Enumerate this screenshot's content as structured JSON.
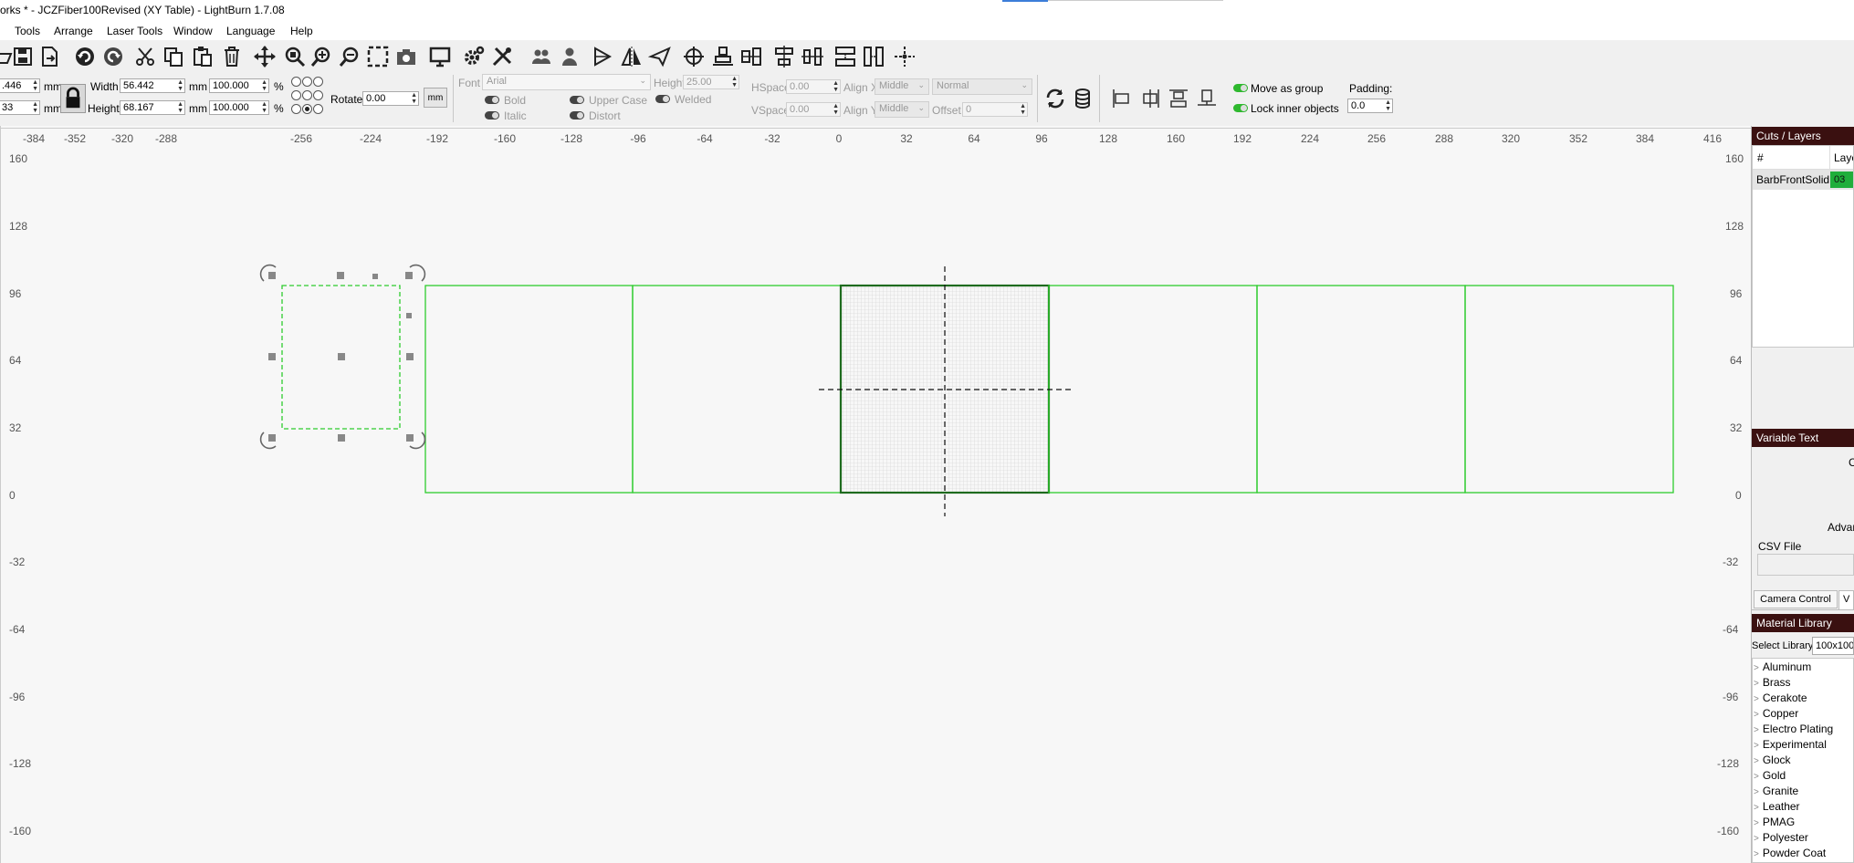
{
  "window": {
    "title": "orks * - JCZFiber100Revised (XY Table) - LightBurn 1.7.08"
  },
  "menu": {
    "items": [
      "Tools",
      "Arrange",
      "Laser Tools",
      "Window",
      "Language",
      "Help"
    ]
  },
  "toolbar": {
    "icons": [
      "open-icon",
      "save-icon",
      "export-icon",
      "undo-icon",
      "redo-icon",
      "cut-icon",
      "copy-icon",
      "paste-icon",
      "delete-icon",
      "move-icon",
      "zoom-page-icon",
      "zoom-in-icon",
      "zoom-out-icon",
      "frame-select-icon",
      "camera-icon",
      "monitor-icon",
      "settings-icon",
      "tools-icon",
      "group-icon",
      "ungroup-icon",
      "mirror-h-icon",
      "mirror-v-icon",
      "send-icon",
      "center-icon",
      "align-bottom-icon",
      "align-vcenter-icon",
      "distribute-h-icon",
      "distribute-v-icon",
      "dock-h-icon",
      "dock-v-icon",
      "move-origin-icon"
    ]
  },
  "props": {
    "x_value": ".446",
    "y_value": "33",
    "unit_mm": "mm",
    "width_label": "Width",
    "width_value": "56.442",
    "width_pct": "100.000",
    "height_label": "Height",
    "height_value": "68.167",
    "height_pct": "100.000",
    "pct": "%",
    "rotate_label": "Rotate",
    "rotate_value": "0.00",
    "mm_button": "mm"
  },
  "text_tools": {
    "font_label": "Font",
    "font_value": "Arial",
    "height_label": "Height",
    "height_value": "25.00",
    "hspace_label": "HSpace",
    "hspace_value": "0.00",
    "vspace_label": "VSpace",
    "vspace_value": "0.00",
    "alignx_label": "Align X",
    "alignx_value": "Middle",
    "aligny_label": "Align Y",
    "aligny_value": "Middle",
    "normal_value": "Normal",
    "offset_label": "Offset",
    "offset_value": "0",
    "bold": "Bold",
    "italic": "Italic",
    "upper_case": "Upper Case",
    "distort": "Distort",
    "welded": "Welded"
  },
  "group_opts": {
    "move_as_group": "Move as group",
    "lock_inner": "Lock inner objects",
    "padding_label": "Padding:",
    "padding_value": "0.0"
  },
  "ruler": {
    "x": [
      "-384",
      "-352",
      "-320",
      "-288",
      "-256",
      "-224",
      "-192",
      "-160",
      "-128",
      "-96",
      "-64",
      "-32",
      "0",
      "32",
      "64",
      "96",
      "128",
      "160",
      "192",
      "224",
      "256",
      "288",
      "320",
      "352",
      "384",
      "416"
    ],
    "y": [
      "160",
      "128",
      "96",
      "64",
      "32",
      "0",
      "-32",
      "-64",
      "-96",
      "-128",
      "-160"
    ]
  },
  "cuts_layers": {
    "title": "Cuts / Layers",
    "col_num": "#",
    "col_layer": "Laye",
    "row_name": "BarbFrontSolid",
    "row_layer": "03",
    "row_color": "#1fae3b"
  },
  "variable_text": {
    "title": "Variable Text",
    "frag_c": "C",
    "advanced": "Advan",
    "csv_file": "CSV File"
  },
  "tabs": {
    "camera_control": "Camera Control",
    "other": "V"
  },
  "material_library": {
    "title": "Material Library",
    "select_label": "Select Library",
    "select_value": "100x100",
    "items": [
      "Aluminum",
      "Brass",
      "Cerakote",
      "Copper",
      "Electro Plating",
      "Experimental",
      "Glock",
      "Gold",
      "Granite",
      "Leather",
      "PMAG",
      "Polyester",
      "Powder Coat"
    ]
  },
  "colors": {
    "accent": "#3c7dd9",
    "shape_green": "#2ecc2e",
    "selected_green": "#1e6b1e",
    "panel_header": "#3a1010"
  }
}
